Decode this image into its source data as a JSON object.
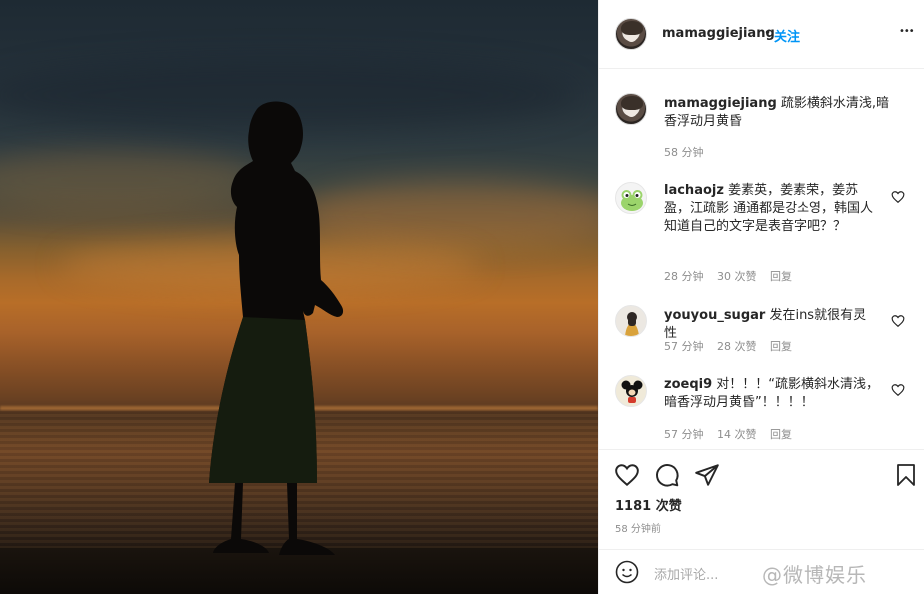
{
  "post": {
    "username": "mamaggiejiang",
    "follow_label": "关注",
    "separator": "•",
    "more_label": "•••"
  },
  "caption": {
    "username": "mamaggiejiang",
    "text": "疏影横斜水清浅,暗香浮动月黄昏",
    "time": "58 分钟"
  },
  "comments": [
    {
      "username": "lachaojz",
      "text": "姜素英，姜素荣，姜苏盈，江疏影 通通都是강소영，韩国人知道自己的文字是表音字吧？？",
      "time": "28 分钟",
      "likes": "30 次赞",
      "reply": "回复",
      "avatar": "frog-avatar"
    },
    {
      "username": "youyou_sugar",
      "text": "发在ins就很有灵性",
      "time": "57 分钟",
      "likes": "28 次赞",
      "reply": "回复",
      "avatar": "girl-avatar"
    },
    {
      "username": "zoeqi9",
      "text": "对！！！“疏影横斜水清浅，暗香浮动月黄昏”！！！！",
      "time": "57 分钟",
      "likes": "14 次赞",
      "reply": "回复",
      "avatar": "mickey-avatar"
    }
  ],
  "stats": {
    "likes": "1181 次赞",
    "time": "58 分钟前"
  },
  "add_comment": {
    "placeholder": "添加评论...",
    "watermark": "@微博娱乐"
  },
  "icons": [
    "heart-icon",
    "comment-icon",
    "share-icon",
    "bookmark-icon",
    "emoji-icon",
    "more-icon"
  ]
}
